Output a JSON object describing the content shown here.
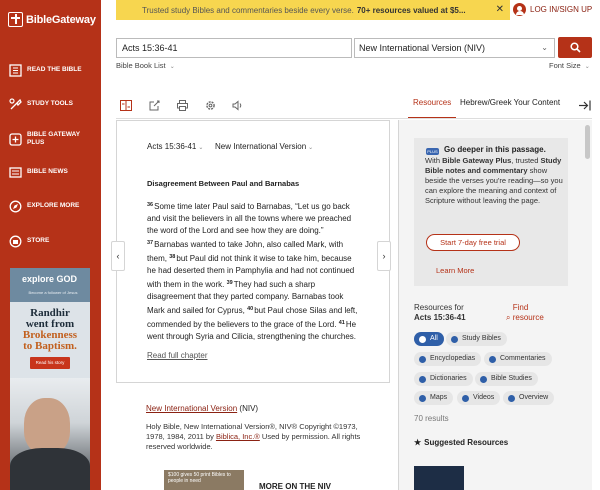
{
  "brand": "BibleGateway",
  "sidebar": {
    "items": [
      {
        "label": "Read the Bible"
      },
      {
        "label": "Study Tools"
      },
      {
        "label": "Bible Gateway Plus"
      },
      {
        "label": "Bible News"
      },
      {
        "label": "Explore More"
      },
      {
        "label": "Store"
      }
    ]
  },
  "ad": {
    "logo": "explore GOD",
    "tagline": "Become a follower of Jesus",
    "headline_1": "Randhir",
    "headline_2": "went from",
    "headline_3": "Brokenness",
    "headline_4": "to Baptism.",
    "button": "Read his story"
  },
  "banner": {
    "text": "Trusted study Bibles and commentaries beside every verse.",
    "bold": "70+ resources valued at $5..."
  },
  "login": "LOG IN/SIGN UP",
  "search": {
    "value": "Acts 15:36-41",
    "version": "New International Version (NIV)"
  },
  "book_list": "Bible Book List",
  "font_size": "Font Size",
  "tabs": {
    "resources": "Resources",
    "hebrew_greek": "Hebrew/Greek Your Content"
  },
  "passage": {
    "reference": "Acts 15:36-41",
    "version": "New International Version",
    "heading": "Disagreement Between Paul and Barnabas",
    "verses": [
      {
        "num": "36",
        "text": "Some time later Paul said to Barnabas, “Let us go back and visit the believers in all the towns where we preached the word of the Lord and see how they are doing.”"
      },
      {
        "num": "37",
        "text": "Barnabas wanted to take John, also called Mark, with them,"
      },
      {
        "num": "38",
        "text": "but Paul did not think it wise to take him, because he had deserted them in Pamphylia and had not continued with them in the work."
      },
      {
        "num": "39",
        "text": "They had such a sharp disagreement that they parted company. Barnabas took Mark and sailed for Cyprus,"
      },
      {
        "num": "40",
        "text": "but Paul chose Silas and left, commended by the believers to the grace of the Lord."
      },
      {
        "num": "41",
        "text": "He went through Syria and Cilicia, strengthening the churches."
      }
    ],
    "read_full": "Read full chapter"
  },
  "copyright": {
    "title_link": "New International Version",
    "title_abbr": "(NIV)",
    "text_1": "Holy Bible, New International Version®, NIV® Copyright ©1973, 1978, 1984, 2011 by",
    "publisher": "Biblica, Inc.®",
    "text_2": "Used by permission. All rights reserved worldwide."
  },
  "book_promo": {
    "thumb_text": "$100 gives 50 print Bibles to people in need",
    "more_on": "MORE ON THE NIV"
  },
  "promo": {
    "badge": "PLUS",
    "title": "Go deeper in this passage.",
    "text_1": "With",
    "text_bold_1": "Bible Gateway Plus",
    "text_2": ", trusted",
    "text_bold_2": "Study Bible notes and commentary",
    "text_3": "show beside the verses you're reading—so you can explore the meaning and context of Scripture without leaving the page.",
    "button": "Start 7-day free trial",
    "learn_more": "Learn More"
  },
  "resources": {
    "for_label": "Resources for",
    "for_ref": "Acts 15:36-41",
    "find": "Find resource",
    "chips": [
      {
        "label": "All",
        "active": true
      },
      {
        "label": "Study Bibles"
      },
      {
        "label": "Encyclopedias"
      },
      {
        "label": "Commentaries"
      },
      {
        "label": "Dictionaries"
      },
      {
        "label": "Bible Studies"
      },
      {
        "label": "Maps"
      },
      {
        "label": "Videos"
      },
      {
        "label": "Overview"
      }
    ],
    "results": "70 results",
    "suggested": "Suggested Resources"
  },
  "colors": {
    "brand_red": "#b53218",
    "banner_yellow": "#f7d64f",
    "chip_blue": "#2f5fa8"
  }
}
